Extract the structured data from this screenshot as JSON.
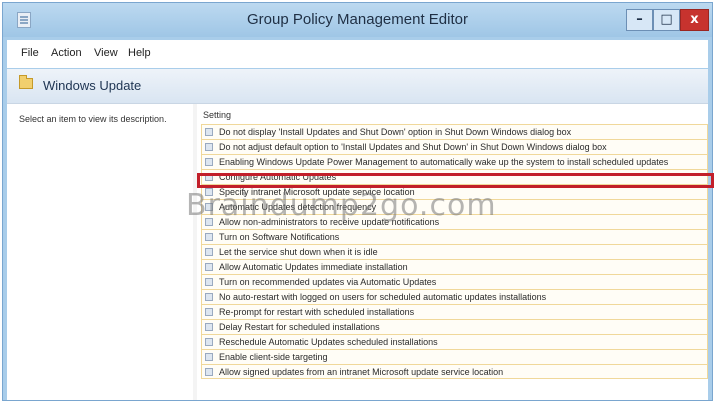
{
  "window": {
    "title": "Group Policy Management Editor",
    "minimize_label": "–",
    "maximize_label": "□",
    "close_label": "x"
  },
  "menu": [
    "File",
    "Action",
    "View",
    "Help"
  ],
  "header": {
    "title": "Windows Update"
  },
  "description_pane": {
    "text": "Select an item to view its description."
  },
  "list": {
    "column_header": "Setting",
    "items": [
      "Do not display 'Install Updates and Shut Down' option in Shut Down Windows dialog box",
      "Do not adjust default option to 'Install Updates and Shut Down' in Shut Down Windows dialog box",
      "Enabling Windows Update Power Management to automatically wake up the system to install scheduled updates",
      "Configure Automatic Updates",
      "Specify intranet Microsoft update service location",
      "Automatic Updates detection frequency",
      "Allow non-administrators to receive update notifications",
      "Turn on Software Notifications",
      "Let the service shut down when it is idle",
      "Allow Automatic Updates immediate installation",
      "Turn on recommended updates via Automatic Updates",
      "No auto-restart with logged on users for scheduled automatic updates installations",
      "Re-prompt for restart with scheduled installations",
      "Delay Restart for scheduled installations",
      "Reschedule Automatic Updates scheduled installations",
      "Enable client-side targeting",
      "Allow signed updates from an intranet Microsoft update service location"
    ],
    "highlighted_item": "Configure Automatic Updates"
  },
  "watermark": "Braindump2go.com",
  "colors": {
    "highlight": "#c21f2a",
    "close_button": "#c7332e"
  }
}
